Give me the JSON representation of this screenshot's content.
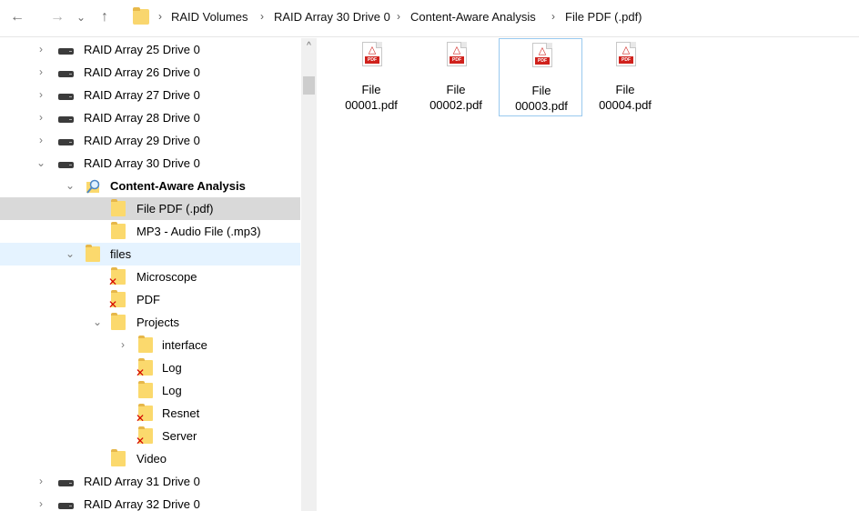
{
  "address_bar": {
    "breadcrumbs": [
      "RAID Volumes",
      "RAID Array 30 Drive 0",
      "Content-Aware Analysis",
      "File PDF (.pdf)"
    ]
  },
  "nav_icons": {
    "back": "←",
    "forward": "→",
    "recent": "⌄",
    "up": "↑"
  },
  "tree": {
    "items": [
      {
        "label": "RAID Array 25 Drive 0",
        "icon": "drive-icon",
        "expander": "›"
      },
      {
        "label": "RAID Array 26 Drive 0",
        "icon": "drive-icon",
        "expander": "›"
      },
      {
        "label": "RAID Array 27 Drive 0",
        "icon": "drive-icon",
        "expander": "›"
      },
      {
        "label": "RAID Array 28 Drive 0",
        "icon": "drive-icon",
        "expander": "›"
      },
      {
        "label": "RAID Array 29 Drive 0",
        "icon": "drive-icon",
        "expander": "›"
      },
      {
        "label": "RAID Array 30 Drive 0",
        "icon": "drive-icon",
        "expander": "⌄"
      },
      {
        "label": "Content-Aware Analysis",
        "icon": "search-folder-icon",
        "expander": "⌄"
      },
      {
        "label": "File PDF (.pdf)",
        "icon": "folder-icon",
        "expander": ""
      },
      {
        "label": "MP3 - Audio File (.mp3)",
        "icon": "folder-icon",
        "expander": ""
      },
      {
        "label": "files",
        "icon": "folder-icon",
        "expander": "⌄"
      },
      {
        "label": "Microscope",
        "icon": "deleted-folder-icon",
        "expander": ""
      },
      {
        "label": "PDF",
        "icon": "deleted-folder-icon",
        "expander": ""
      },
      {
        "label": "Projects",
        "icon": "folder-icon",
        "expander": "⌄"
      },
      {
        "label": "interface",
        "icon": "folder-icon",
        "expander": "›"
      },
      {
        "label": "Log",
        "icon": "deleted-folder-icon",
        "expander": ""
      },
      {
        "label": "Log",
        "icon": "folder-icon",
        "expander": ""
      },
      {
        "label": "Resnet",
        "icon": "deleted-folder-icon",
        "expander": ""
      },
      {
        "label": "Server",
        "icon": "deleted-folder-icon",
        "expander": ""
      },
      {
        "label": "Video",
        "icon": "folder-icon",
        "expander": ""
      },
      {
        "label": "RAID Array 31 Drive 0",
        "icon": "drive-icon",
        "expander": "›"
      },
      {
        "label": "RAID Array 32 Drive 0",
        "icon": "drive-icon",
        "expander": "›"
      }
    ],
    "selected": "File PDF (.pdf)",
    "hovered": "files"
  },
  "scrollbar": {
    "up_arrow": "^"
  },
  "files": [
    {
      "line1": "File",
      "line2": "00001.pdf",
      "icon": "pdf-file-icon",
      "badge": "PDF"
    },
    {
      "line1": "File",
      "line2": "00002.pdf",
      "icon": "pdf-file-icon",
      "badge": "PDF"
    },
    {
      "line1": "File",
      "line2": "00003.pdf",
      "icon": "pdf-file-icon",
      "badge": "PDF"
    },
    {
      "line1": "File",
      "line2": "00004.pdf",
      "icon": "pdf-file-icon",
      "badge": "PDF"
    }
  ],
  "colors": {
    "selection": "#d9d9d9",
    "hover": "#e5f3ff",
    "folder": "#fbd96d",
    "pdf_red": "#d0211c"
  }
}
